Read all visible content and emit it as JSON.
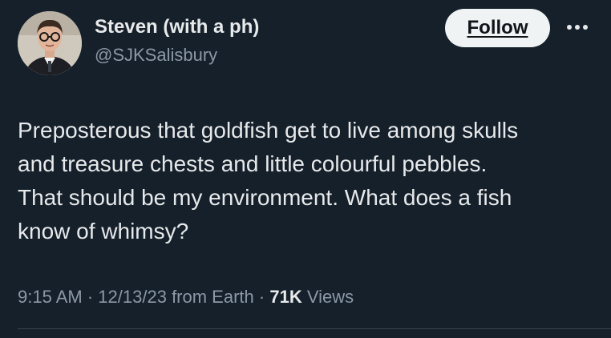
{
  "author": {
    "name": "Steven (with a ph)",
    "handle": "@SJKSalisbury"
  },
  "actions": {
    "follow_label": "Follow",
    "more_icon": "more-horizontal-icon"
  },
  "tweet": {
    "lines": [
      "Preposterous that goldfish get to live among skulls",
      "and treasure chests and little colourful pebbles.",
      "That should be my environment. What does a fish",
      "know of whimsy?"
    ]
  },
  "meta": {
    "time": "9:15 AM",
    "date": "12/13/23",
    "source": "from Earth",
    "views_count": "71K",
    "views_label": "Views"
  },
  "colors": {
    "background": "#15202b",
    "text_primary": "#e7e9ea",
    "text_secondary": "#8b98a5",
    "follow_bg": "#eff3f4",
    "follow_text": "#0f1419"
  }
}
